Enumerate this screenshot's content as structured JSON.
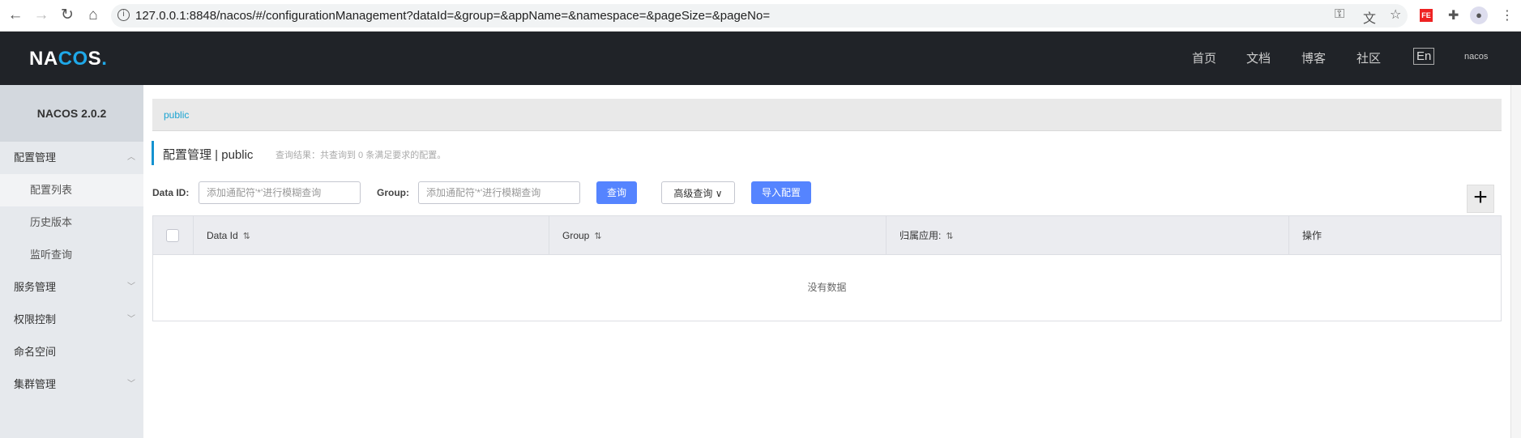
{
  "browser": {
    "url": "127.0.0.1:8848/nacos/#/configurationManagement?dataId=&group=&appName=&namespace=&pageSize=&pageNo="
  },
  "header": {
    "logo": "NACOS.",
    "nav": [
      "首页",
      "文档",
      "博客",
      "社区"
    ],
    "lang": "En",
    "user": "nacos"
  },
  "sidebar": {
    "title": "NACOS 2.0.2",
    "items": [
      {
        "label": "配置管理"
      },
      {
        "label": "配置列表"
      },
      {
        "label": "历史版本"
      },
      {
        "label": "监听查询"
      },
      {
        "label": "服务管理"
      },
      {
        "label": "权限控制"
      },
      {
        "label": "命名空间"
      },
      {
        "label": "集群管理"
      }
    ]
  },
  "main": {
    "breadcrumb": "public",
    "title": "配置管理 | public",
    "result": "查询结果：共查询到 0 条满足要求的配置。",
    "search": {
      "data_id_label": "Data ID:",
      "data_id_placeholder": "添加通配符'*'进行模糊查询",
      "group_label": "Group:",
      "group_placeholder": "添加通配符'*'进行模糊查询",
      "query": "查询",
      "advanced": "高级查询",
      "import": "导入配置"
    },
    "table": {
      "columns": [
        "Data Id",
        "Group",
        "归属应用:",
        "操作"
      ],
      "empty": "没有数据"
    }
  }
}
